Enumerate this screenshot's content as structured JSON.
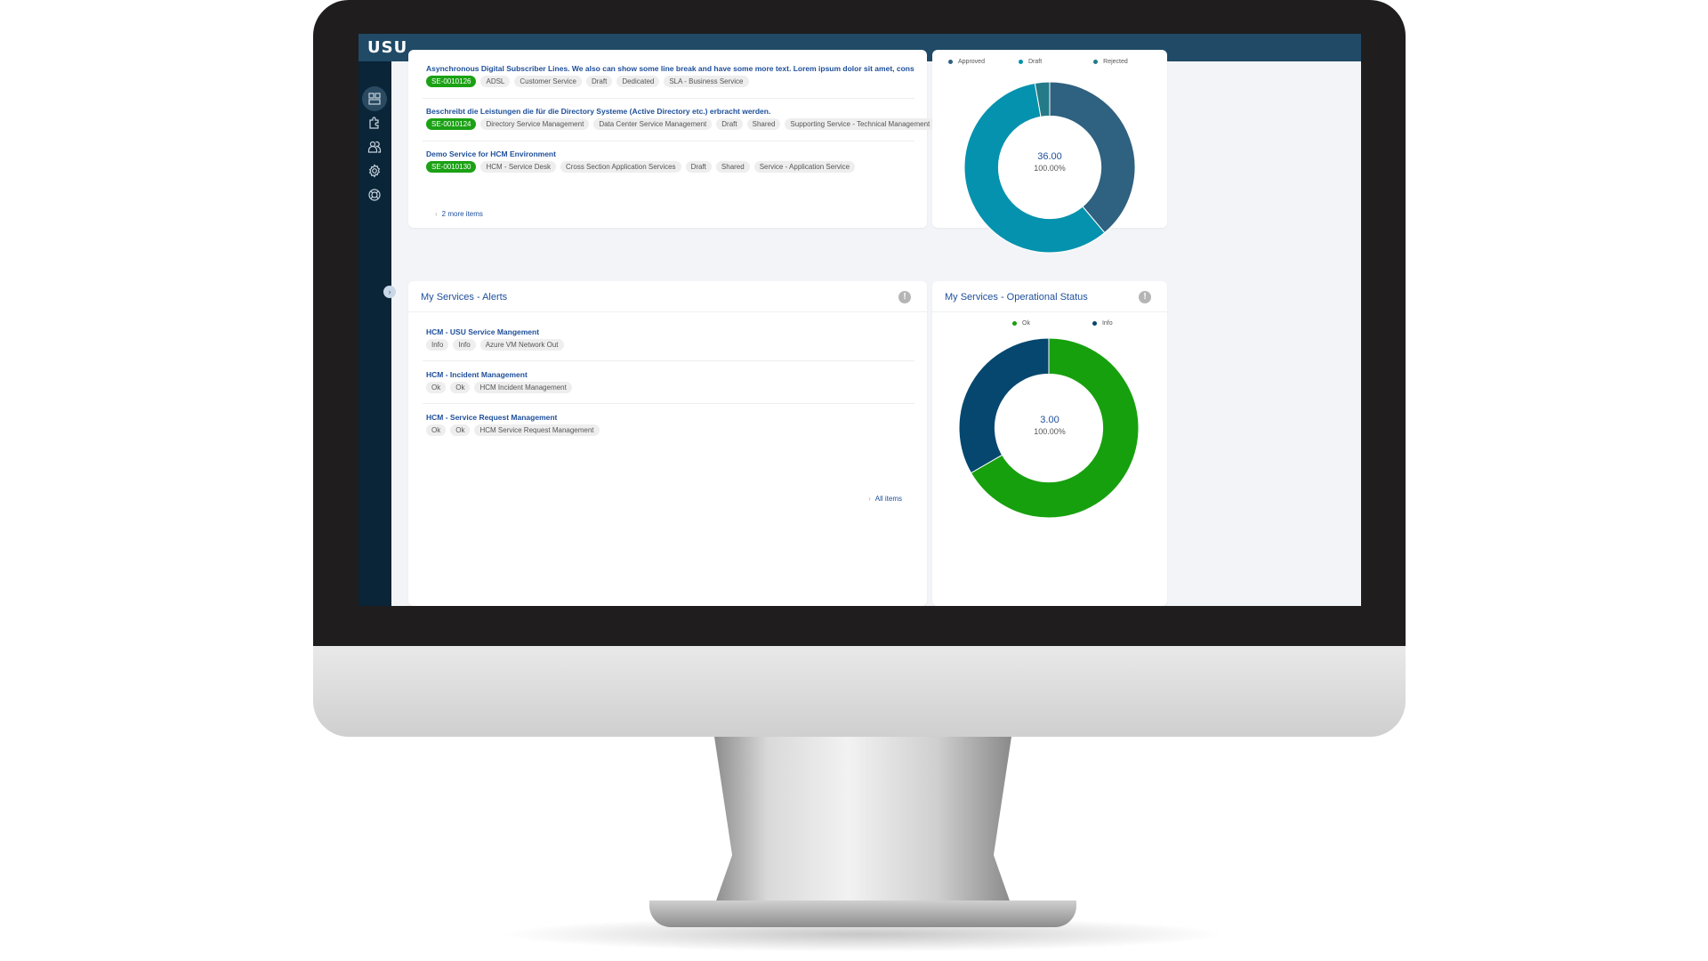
{
  "app": {
    "logo": "USU"
  },
  "sidebar": {
    "items": [
      {
        "name": "dashboard",
        "icon": "dashboard-icon",
        "active": true
      },
      {
        "name": "services",
        "icon": "puzzle-icon",
        "active": false
      },
      {
        "name": "users",
        "icon": "users-icon",
        "active": false
      },
      {
        "name": "settings",
        "icon": "gear-icon",
        "active": false
      },
      {
        "name": "support",
        "icon": "lifebuoy-icon",
        "active": false
      }
    ],
    "collapse_glyph": "›"
  },
  "services_list": {
    "items": [
      {
        "title": "Asynchronous Digital Subscriber Lines. We also can show some line break and have some more text. Lorem ipsum dolor sit amet, consetetur sadipscing elitr, sed diam nonumy eirmod tempor invidunt",
        "id": "SE-0010126",
        "tags": [
          "ADSL",
          "Customer Service",
          "Draft",
          "Dedicated",
          "SLA - Business Service"
        ]
      },
      {
        "title": "Beschreibt die Leistungen die für die Directory Systeme (Active Directory etc.) erbracht werden.",
        "id": "SE-0010124",
        "tags": [
          "Directory Service Management",
          "Data Center Service Management",
          "Draft",
          "Shared",
          "Supporting Service - Technical Management"
        ]
      },
      {
        "title": "Demo Service for HCM Environment",
        "id": "SE-0010130",
        "tags": [
          "HCM - Service Desk",
          "Cross Section Application Services",
          "Draft",
          "Shared",
          "Service - Application Service"
        ]
      }
    ],
    "more_link": "2 more items",
    "chevron": "›"
  },
  "alerts": {
    "title": "My Services - Alerts",
    "info_glyph": "!",
    "items": [
      {
        "title": "HCM - USU Service Mangement",
        "tags": [
          "Info",
          "Info",
          "Azure VM Network Out"
        ]
      },
      {
        "title": "HCM - Incident Management",
        "tags": [
          "Ok",
          "Ok",
          "HCM Incident Management"
        ]
      },
      {
        "title": "HCM - Service Request Management",
        "tags": [
          "Ok",
          "Ok",
          "HCM Service Request Management"
        ]
      }
    ],
    "all_link": "All items",
    "chevron": "›"
  },
  "status_chart_card": {
    "center_value": "36.00",
    "center_pct": "100.00%"
  },
  "operational_card": {
    "title": "My Services - Operational Status",
    "info_glyph": "!",
    "center_value": "3.00",
    "center_pct": "100.00%"
  },
  "colors": {
    "topbar": "#204a66",
    "sidebar": "#0a2438",
    "link": "#1e4f9a",
    "id_badge": "#1ba114"
  },
  "chart_data": [
    {
      "type": "pie",
      "title": "",
      "categories": [
        "Approved",
        "Draft",
        "Rejected"
      ],
      "values": [
        14,
        21,
        1
      ],
      "colors": [
        "#2f6180",
        "#0592ae",
        "#247b87"
      ],
      "total": 36,
      "legend": "top"
    },
    {
      "type": "pie",
      "title": "My Services - Operational Status",
      "categories": [
        "Ok",
        "Info"
      ],
      "values": [
        2,
        1
      ],
      "colors": [
        "#17a00e",
        "#05476f"
      ],
      "total": 3,
      "legend": "top"
    }
  ]
}
